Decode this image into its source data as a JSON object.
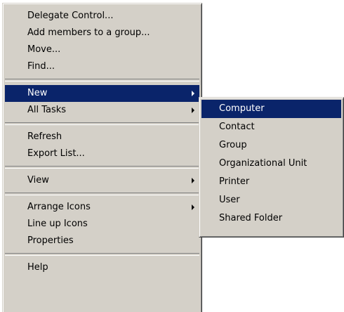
{
  "context_menu": {
    "group1": {
      "delegate_control": "Delegate Control...",
      "add_members": "Add members to a group...",
      "move": "Move...",
      "find": "Find..."
    },
    "group2": {
      "new": "New",
      "all_tasks": "All Tasks"
    },
    "group3": {
      "refresh": "Refresh",
      "export_list": "Export List..."
    },
    "group4": {
      "view": "View"
    },
    "group5": {
      "arrange_icons": "Arrange Icons",
      "line_up_icons": "Line up Icons",
      "properties": "Properties"
    },
    "group6": {
      "help": "Help"
    }
  },
  "new_submenu": {
    "items": [
      "Computer",
      "Contact",
      "Group",
      "Organizational Unit",
      "Printer",
      "User",
      "Shared Folder"
    ]
  },
  "colors": {
    "menu_face": "#d4d0c8",
    "highlight": "#0a246a",
    "highlight_text": "#ffffff"
  },
  "icons": {
    "submenu_arrow": "triangle-right-icon"
  }
}
